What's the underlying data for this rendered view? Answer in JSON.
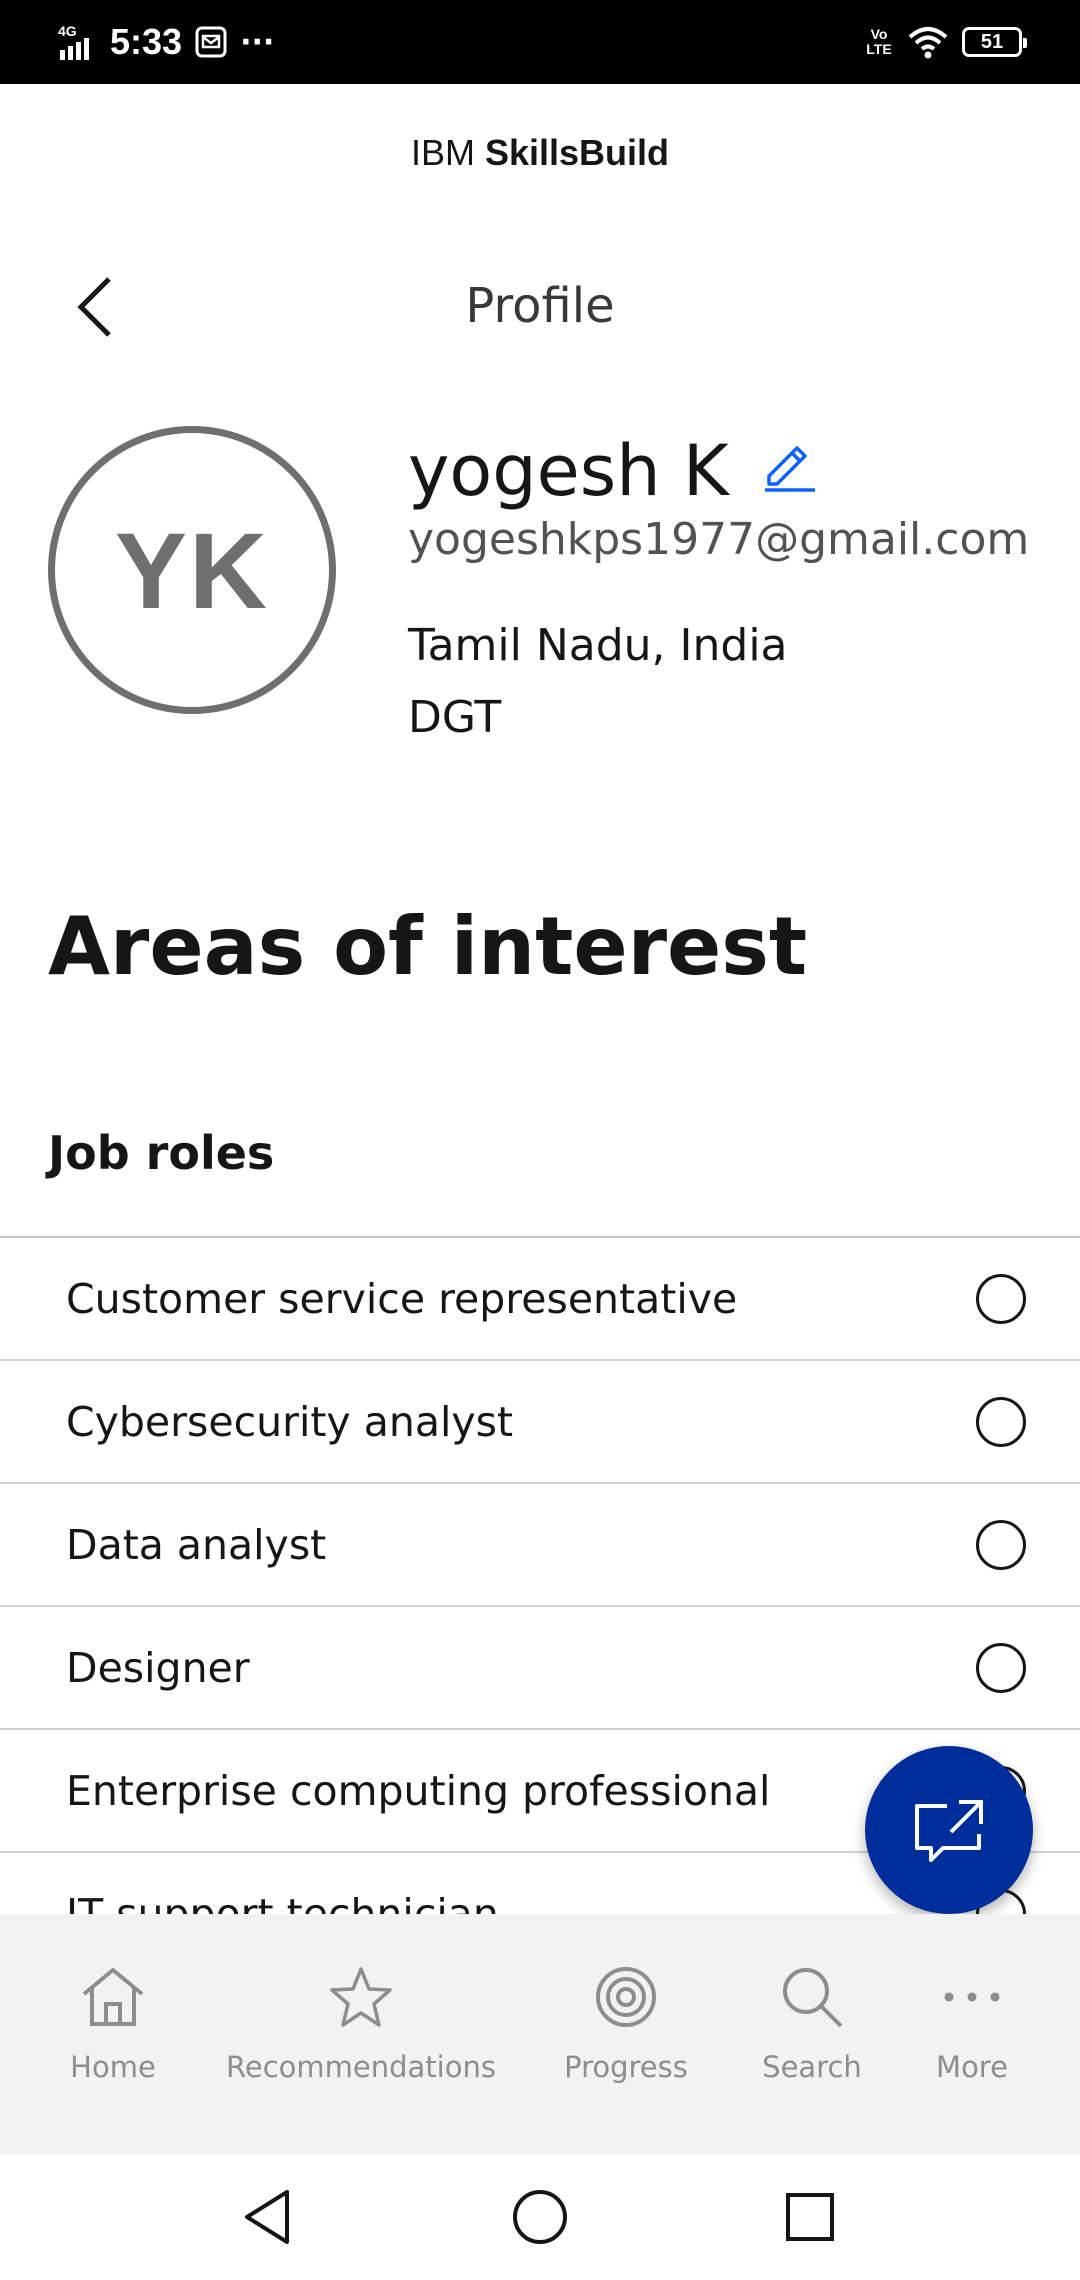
{
  "status_bar": {
    "network": "4G",
    "time": "5:33",
    "more": "···",
    "volte": "Vo LTE",
    "battery": "51"
  },
  "brand": {
    "prefix": "IBM",
    "name": "SkillsBuild"
  },
  "page_title": "Profile",
  "profile": {
    "initials": "YK",
    "name": "yogesh K",
    "email": "yogeshkps1977@gmail.com",
    "location": "Tamil Nadu, India",
    "organization": "DGT"
  },
  "interests": {
    "title": "Areas of interest",
    "job_roles_title": "Job roles",
    "job_roles": [
      {
        "label": "Customer service representative",
        "selected": false
      },
      {
        "label": "Cybersecurity analyst",
        "selected": false
      },
      {
        "label": "Data analyst",
        "selected": false
      },
      {
        "label": "Designer",
        "selected": false
      },
      {
        "label": "Enterprise computing professional",
        "selected": false
      },
      {
        "label": "IT support technician",
        "selected": false
      }
    ]
  },
  "bottom_nav": {
    "items": [
      {
        "label": "Home",
        "icon": "home-icon"
      },
      {
        "label": "Recommendations",
        "icon": "star-icon"
      },
      {
        "label": "Progress",
        "icon": "progress-icon"
      },
      {
        "label": "Search",
        "icon": "search-icon"
      },
      {
        "label": "More",
        "icon": "more-icon"
      }
    ]
  },
  "colors": {
    "accent": "#002d9c",
    "edit_icon": "#0f62fe",
    "nav_inactive": "#8d8d8d",
    "avatar_ring": "#6f6f6f"
  }
}
